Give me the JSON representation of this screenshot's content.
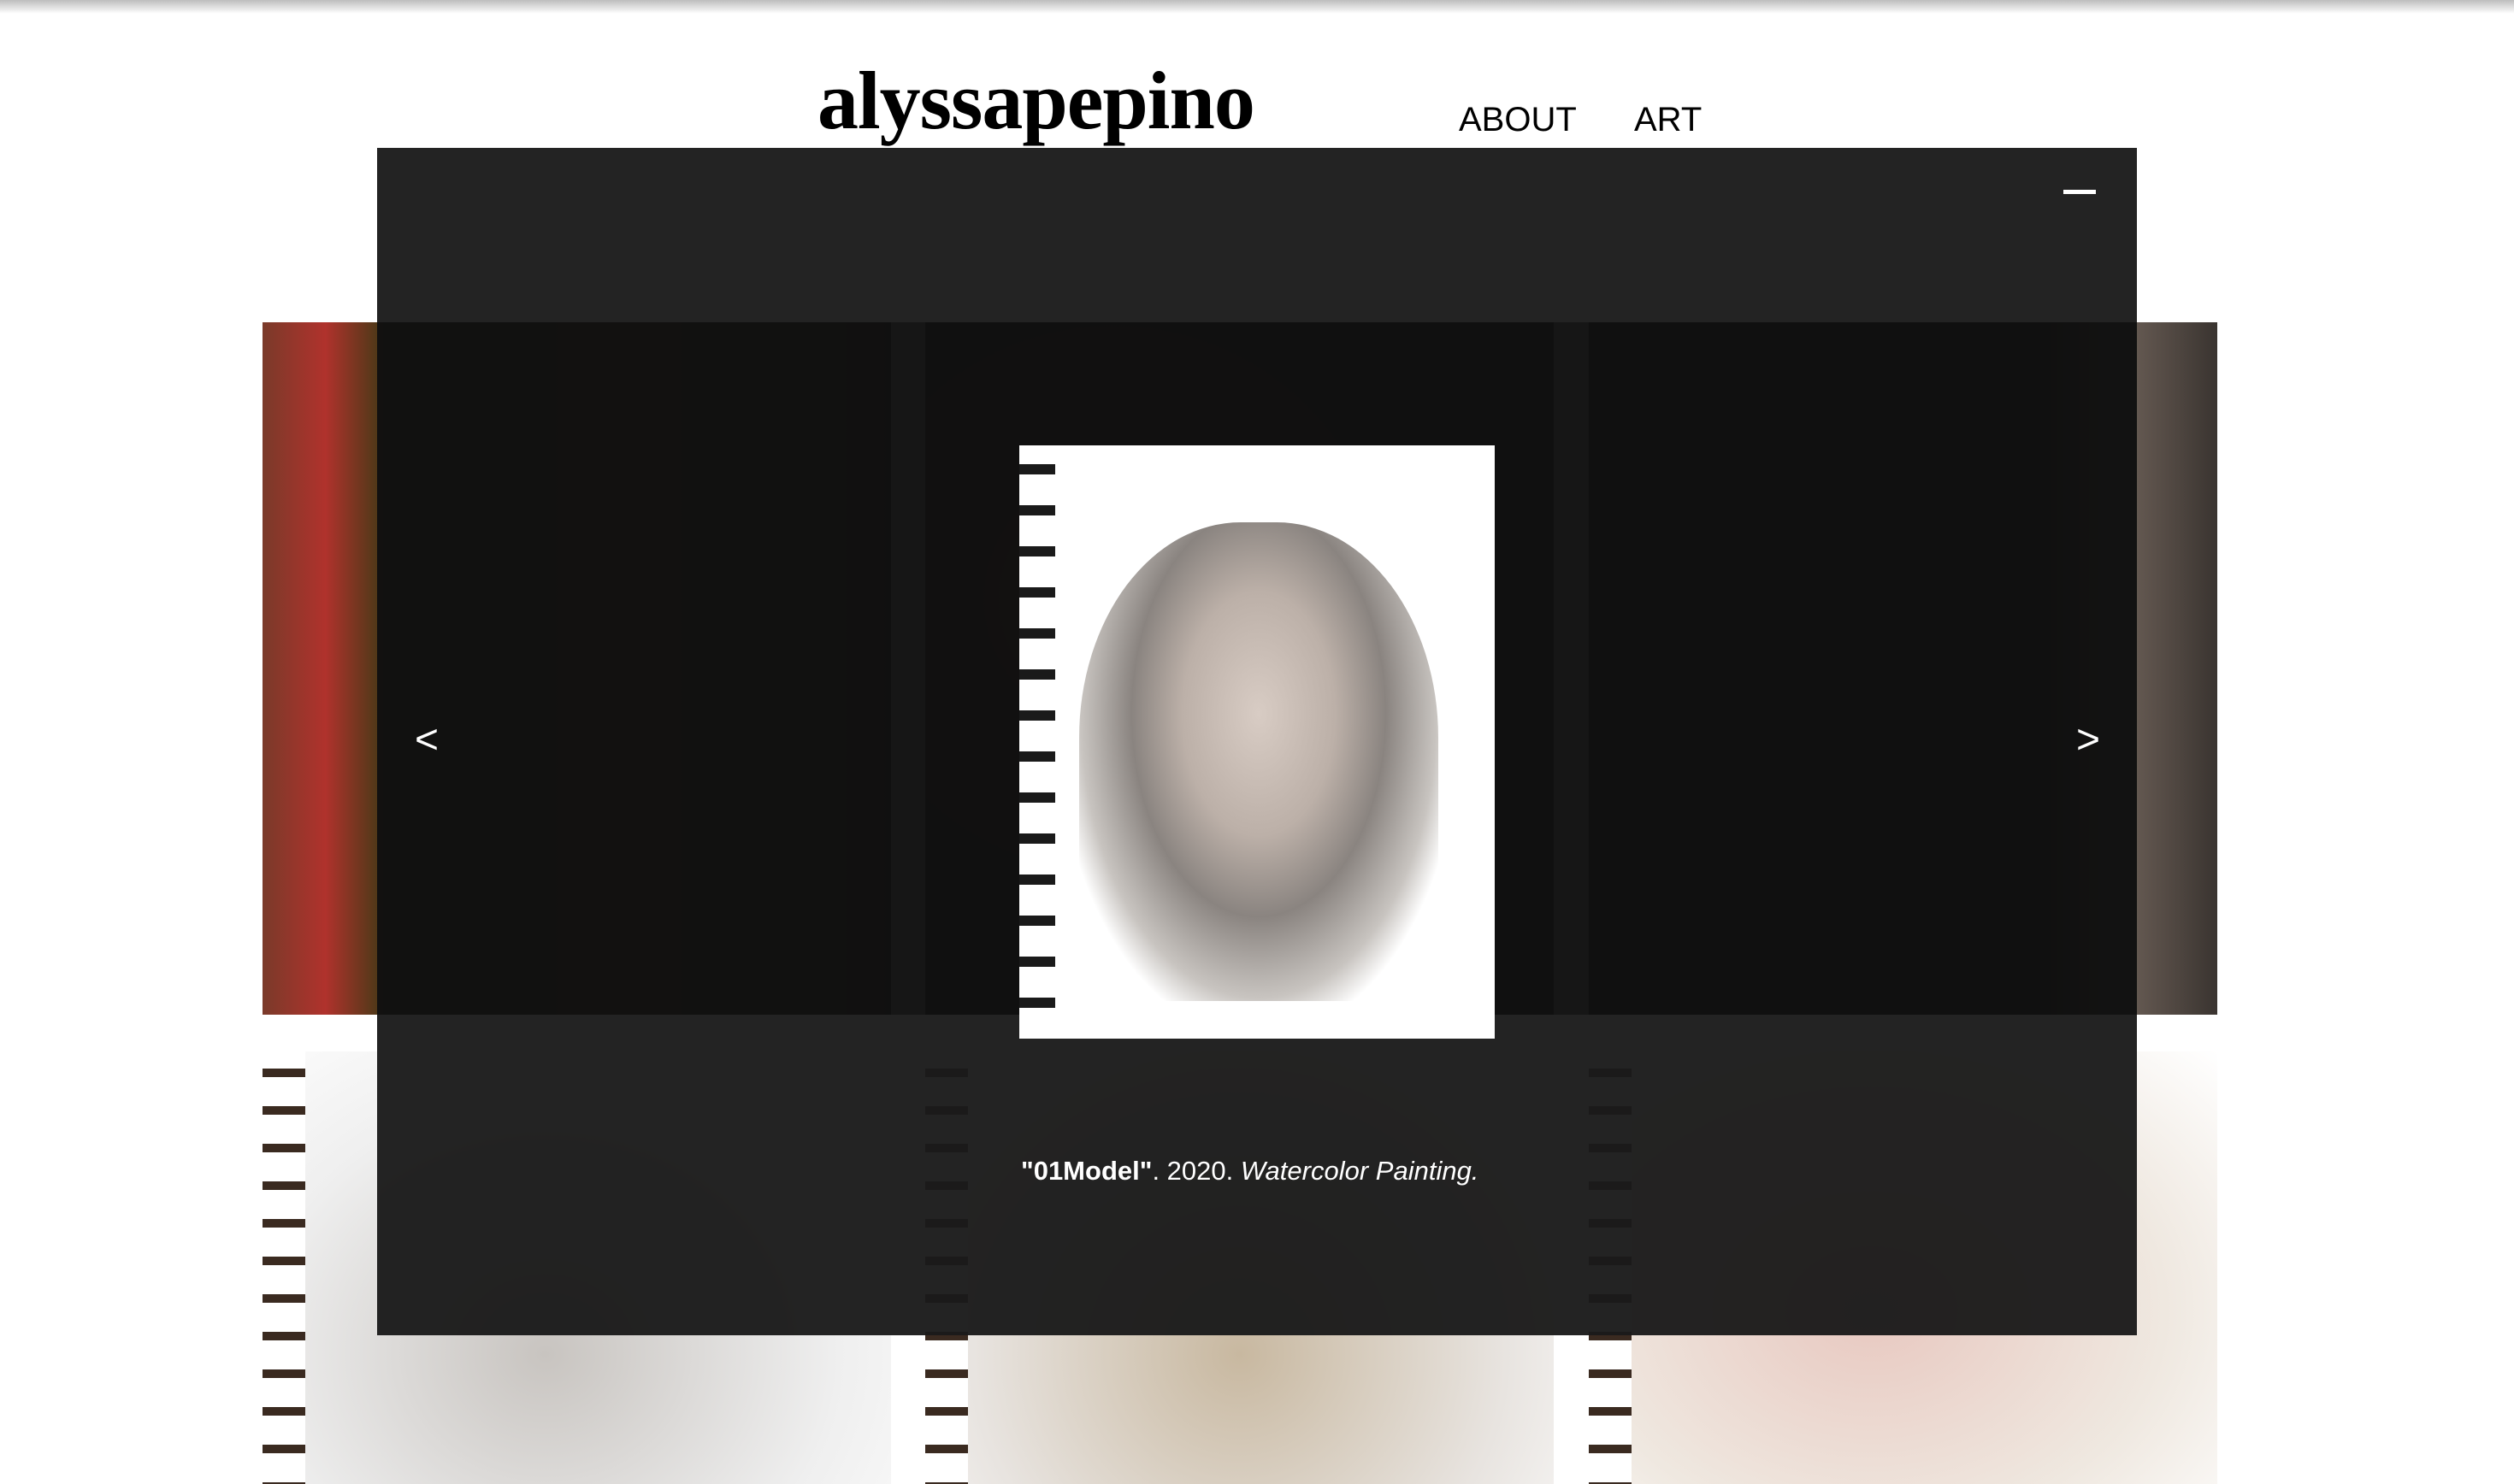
{
  "header": {
    "logo": "alyssapepino",
    "nav": [
      "ABOUT",
      "ART"
    ]
  },
  "lightbox": {
    "caption": {
      "title": "\"01Model\"",
      "year": ". 2020. ",
      "medium": "Watercolor Painting."
    },
    "prev": "<",
    "next": ">"
  }
}
